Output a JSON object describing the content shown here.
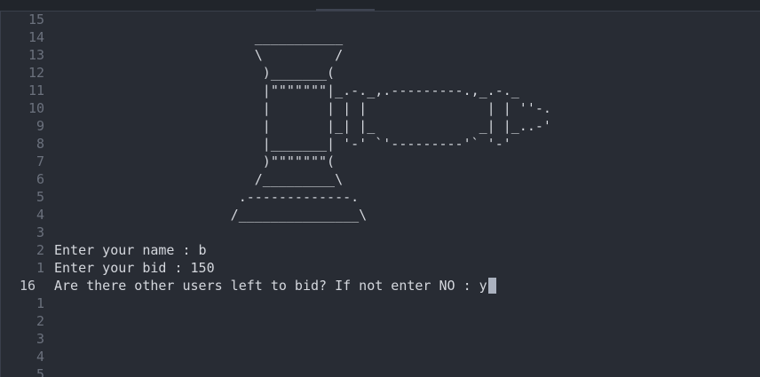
{
  "gutter": {
    "numbers": [
      "15",
      "14",
      "13",
      "12",
      "11",
      "10",
      "9",
      "8",
      "7",
      "6",
      "5",
      "4",
      "3",
      "2",
      "1",
      "16",
      "1",
      "2",
      "3",
      "4",
      "5"
    ],
    "current_index": 15
  },
  "terminal": {
    "ascii_art": [
      "",
      "                         ___________",
      "                         \\         /",
      "                          )_______(",
      "                          |\"\"\"\"\"\"\"|_.-._,.---------.,_.-._",
      "                          |       | | |               | | ''-.",
      "                          |       |_| |_             _| |_..-'",
      "                          |_______| '-' `'---------'` '-'",
      "                          )\"\"\"\"\"\"\"(",
      "                         /_________\\",
      "                       .-------------.",
      "                      /_______________\\",
      ""
    ],
    "prompt_name": "Enter your name : b",
    "prompt_bid": "Enter your bid : 150",
    "prompt_more": "Are there other users left to bid? If not enter NO : ",
    "input_value": "y",
    "trailing_lines": [
      "",
      "",
      "",
      "",
      ""
    ]
  },
  "colors": {
    "background": "#282c34",
    "text": "#d4d7dd",
    "line_number": "#6b717d"
  }
}
